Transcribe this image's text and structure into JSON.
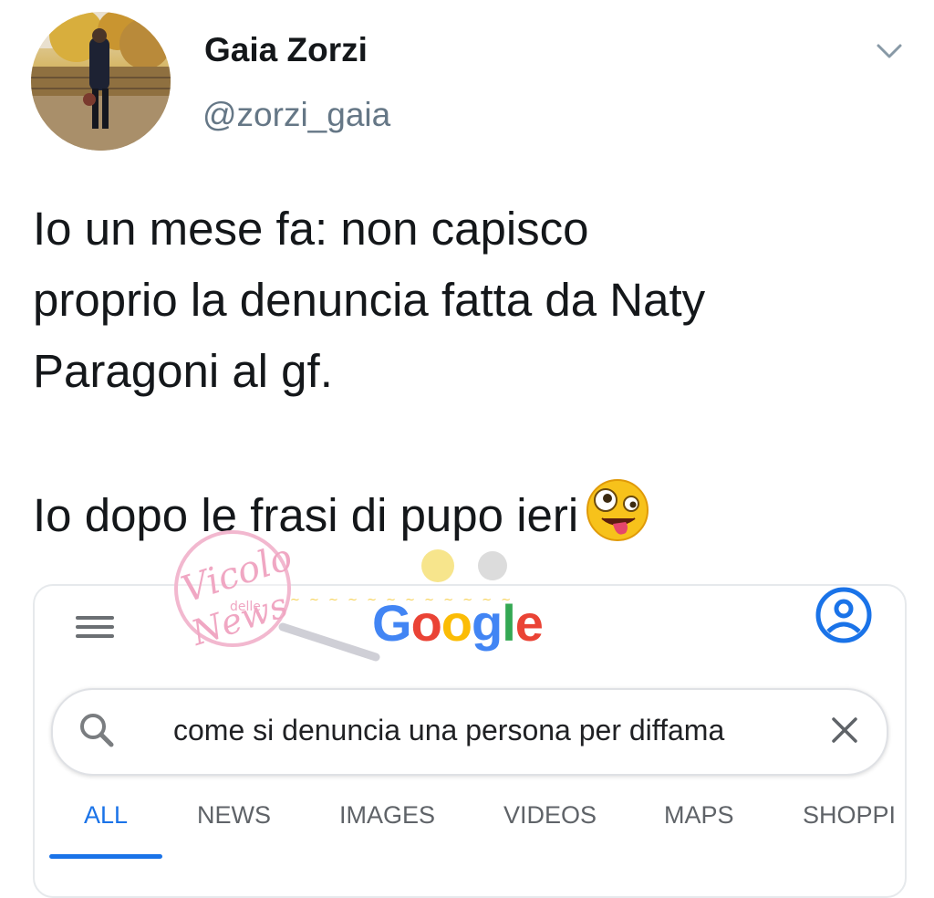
{
  "tweet": {
    "display_name": "Gaia Zorzi",
    "handle": "@zorzi_gaia",
    "lines_1": [
      "Io un mese fa: non capisco",
      "proprio la denuncia fatta da Naty",
      "Paragoni al gf."
    ],
    "line_2": "Io dopo le frasi di pupo ieri",
    "emoji": "zany-face-emoji"
  },
  "google": {
    "logo": "Google",
    "query": "come si denuncia una persona per diffama",
    "tabs": [
      "ALL",
      "NEWS",
      "IMAGES",
      "VIDEOS",
      "MAPS",
      "SHOPPI"
    ],
    "active_tab": "ALL",
    "accent": "#1a73e8"
  },
  "watermark": {
    "line1": "Vicolo",
    "line2": "delle",
    "line3": "News"
  }
}
